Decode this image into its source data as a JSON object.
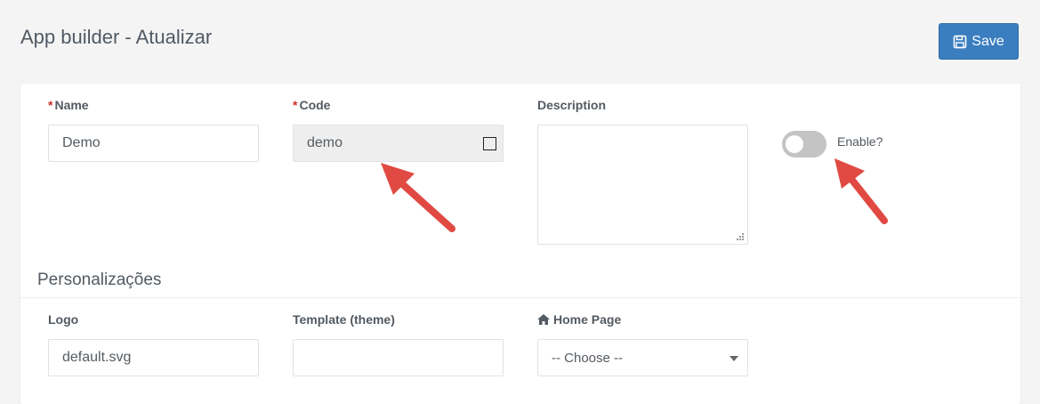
{
  "header": {
    "title": "App builder - Atualizar",
    "save_label": "Save"
  },
  "form": {
    "name": {
      "label": "Name",
      "required_mark": "*",
      "value": "Demo"
    },
    "code": {
      "label": "Code",
      "required_mark": "*",
      "value": "demo"
    },
    "description": {
      "label": "Description",
      "value": ""
    },
    "enable": {
      "label": "Enable?",
      "checked": false
    }
  },
  "personalization": {
    "title": "Personalizações",
    "logo": {
      "label": "Logo",
      "value": "default.svg"
    },
    "template": {
      "label": "Template (theme)",
      "value": ""
    },
    "home_page": {
      "label": "Home Page",
      "icon": "home-icon",
      "selected": "-- Choose --"
    }
  },
  "colors": {
    "accent": "#3a7ebf",
    "required": "#c9302c",
    "annotation_arrow": "#e04a43",
    "toggle_off": "#c4c4c4"
  }
}
